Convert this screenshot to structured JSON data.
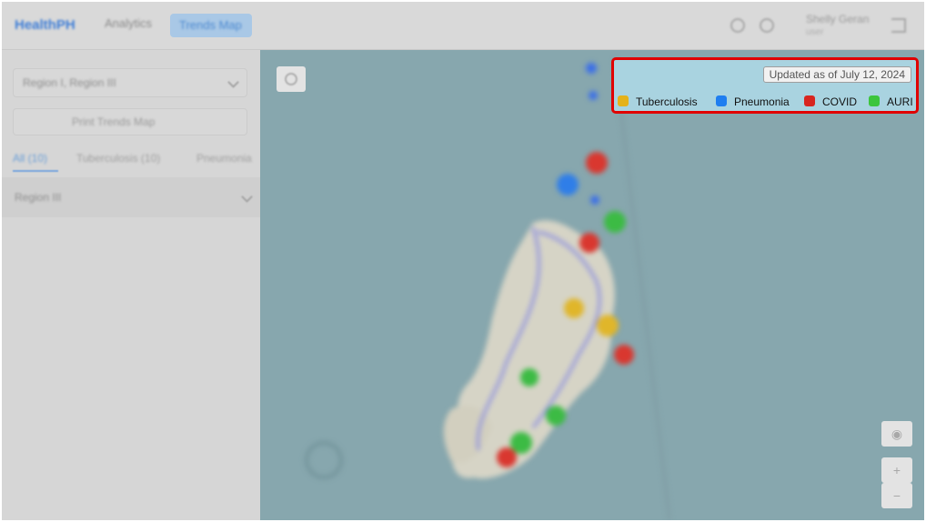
{
  "app": {
    "brand": "HealthPH",
    "nav": [
      {
        "label": "Analytics"
      },
      {
        "label": "Trends Map"
      }
    ],
    "user": {
      "name": "Shelly Geran",
      "role": "user"
    }
  },
  "sidebar": {
    "region_select_value": "Region I, Region III",
    "print_button_label": "Print Trends Map",
    "tabs": [
      {
        "label": "All (10)"
      },
      {
        "label": "Tuberculosis (10)"
      },
      {
        "label": "Pneumonia"
      }
    ],
    "accordion_label": "Region III"
  },
  "map": {
    "zoom_in": "+",
    "zoom_out": "−",
    "legend": {
      "updated_text": "Updated as of July 12, 2024",
      "items": [
        {
          "label": "Tuberculosis",
          "color": "#e5b21a"
        },
        {
          "label": "Pneumonia",
          "color": "#1f7ef0"
        },
        {
          "label": "COVID",
          "color": "#d8251f"
        },
        {
          "label": "AURI",
          "color": "#3cc53c"
        }
      ]
    }
  },
  "colors": {
    "legend_bg": "#a9d3e0",
    "highlight_border": "#e00000",
    "map_water": "#87a7ae"
  }
}
